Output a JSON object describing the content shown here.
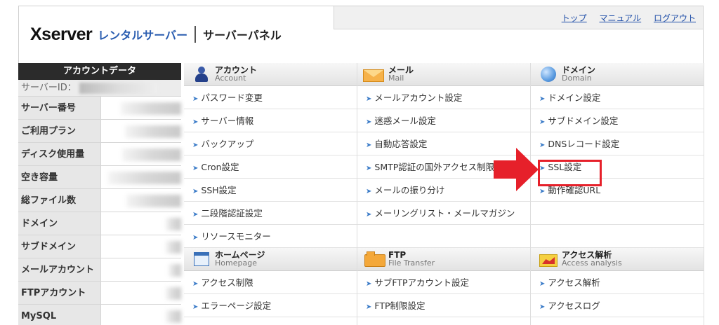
{
  "header": {
    "brand": "Xserver",
    "rental": "レンタルサーバー",
    "panel": "サーバーパネル",
    "links": [
      "トップ",
      "マニュアル",
      "ログアウト"
    ]
  },
  "sidebar": {
    "title": "アカウントデータ",
    "id_label": "サーバーID：",
    "rows": [
      {
        "label": "サーバー番号"
      },
      {
        "label": "ご利用プラン"
      },
      {
        "label": "ディスク使用量"
      },
      {
        "label": "空き容量"
      },
      {
        "label": "総ファイル数"
      },
      {
        "label": "ドメイン"
      },
      {
        "label": "サブドメイン"
      },
      {
        "label": "メールアカウント"
      },
      {
        "label": "FTPアカウント"
      },
      {
        "label": "MySQL"
      }
    ]
  },
  "sections": {
    "account": {
      "jp": "アカウント",
      "en": "Account",
      "items": [
        "パスワード変更",
        "サーバー情報",
        "バックアップ",
        "Cron設定",
        "SSH設定",
        "二段階認証設定",
        "リソースモニター"
      ]
    },
    "mail": {
      "jp": "メール",
      "en": "Mail",
      "items": [
        "メールアカウント設定",
        "迷惑メール設定",
        "自動応答設定",
        "SMTP認証の国外アクセス制限設定",
        "メールの振り分け",
        "メーリングリスト・メールマガジン"
      ]
    },
    "domain": {
      "jp": "ドメイン",
      "en": "Domain",
      "items": [
        "ドメイン設定",
        "サブドメイン設定",
        "DNSレコード設定",
        "SSL設定",
        "動作確認URL"
      ]
    },
    "homepage": {
      "jp": "ホームページ",
      "en": "Homepage",
      "items": [
        "アクセス制限",
        "エラーページ設定"
      ]
    },
    "ftp": {
      "jp": "FTP",
      "en": "File Transfer",
      "items": [
        "サブFTPアカウント設定",
        "FTP制限設定"
      ]
    },
    "analysis": {
      "jp": "アクセス解析",
      "en": "Access analysis",
      "items": [
        "アクセス解析",
        "アクセスログ"
      ]
    }
  },
  "colors": {
    "highlight": "#e6202a",
    "link": "#1f4ea8",
    "arrow": "#3a7bc8"
  }
}
